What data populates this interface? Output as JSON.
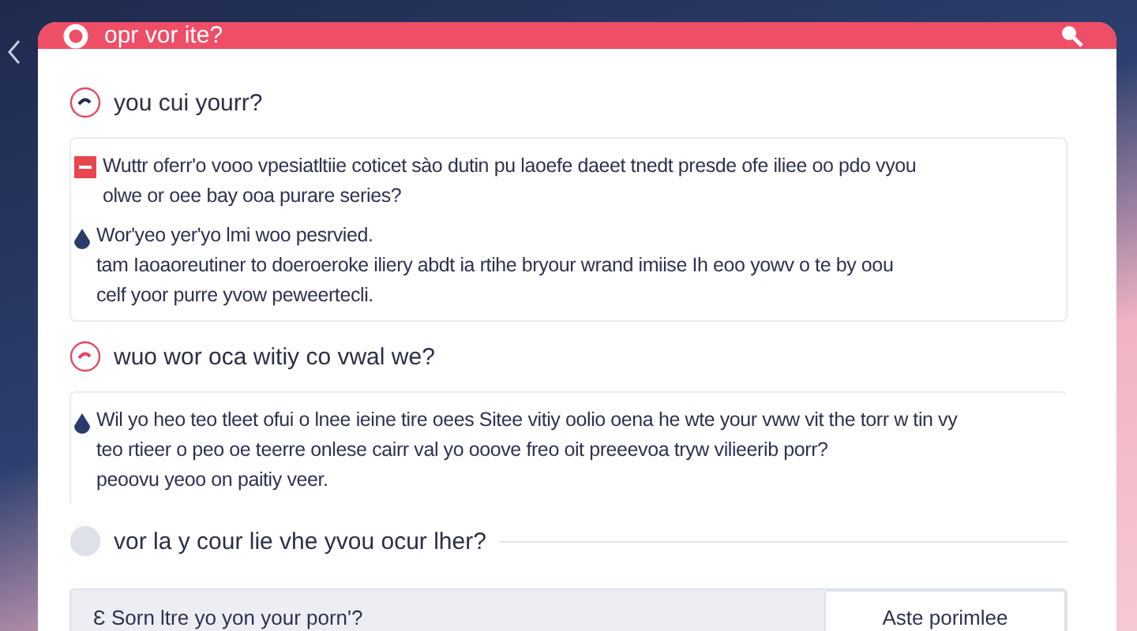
{
  "header": {
    "title": "opr vor ite?"
  },
  "questions": [
    {
      "kind": "open",
      "label": "you cui yourr?",
      "answer": [
        {
          "kind": "flag",
          "text": "Wuttr oferr'o vooo vpesiatltiie coticet sào dutin pu laoefe daeet tnedt presde ofe iliee oo pdo vyou\nolwe or oee bay ooa purare series?"
        },
        {
          "kind": "drop",
          "text": "Wor'yeo yer'yo lmi woo pesrvied.\ntam Iaoaoreutiner to doeroeroke iliery abdt ia rtihe bryour wrand imiise Ih eoo yowv o te by oou\ncelf yoor purre yvow peweertecli."
        }
      ]
    },
    {
      "kind": "highlight",
      "label": "wuo wor oca witiy co vwal we?",
      "answer": [
        {
          "kind": "drop",
          "text": "Wil yo heo teo tleet ofui o lnee ieine tire oees Sitee vitiy oolio oena he wte your vww vit the torr w tin vy\nteo rtieer o peo oe teerre onlese cairr val yo ooove freo oit preeevoa tryw vilieerib porr?\npeoovu yeoo on paitiy veer."
        }
      ]
    },
    {
      "kind": "pending",
      "label": "vor la y cour lie vhe yvou ocur lher?"
    }
  ],
  "reply": {
    "placeholder": "Ɛ Sorn ltre yo yon your porn'?",
    "button": "Aste porimlee"
  }
}
